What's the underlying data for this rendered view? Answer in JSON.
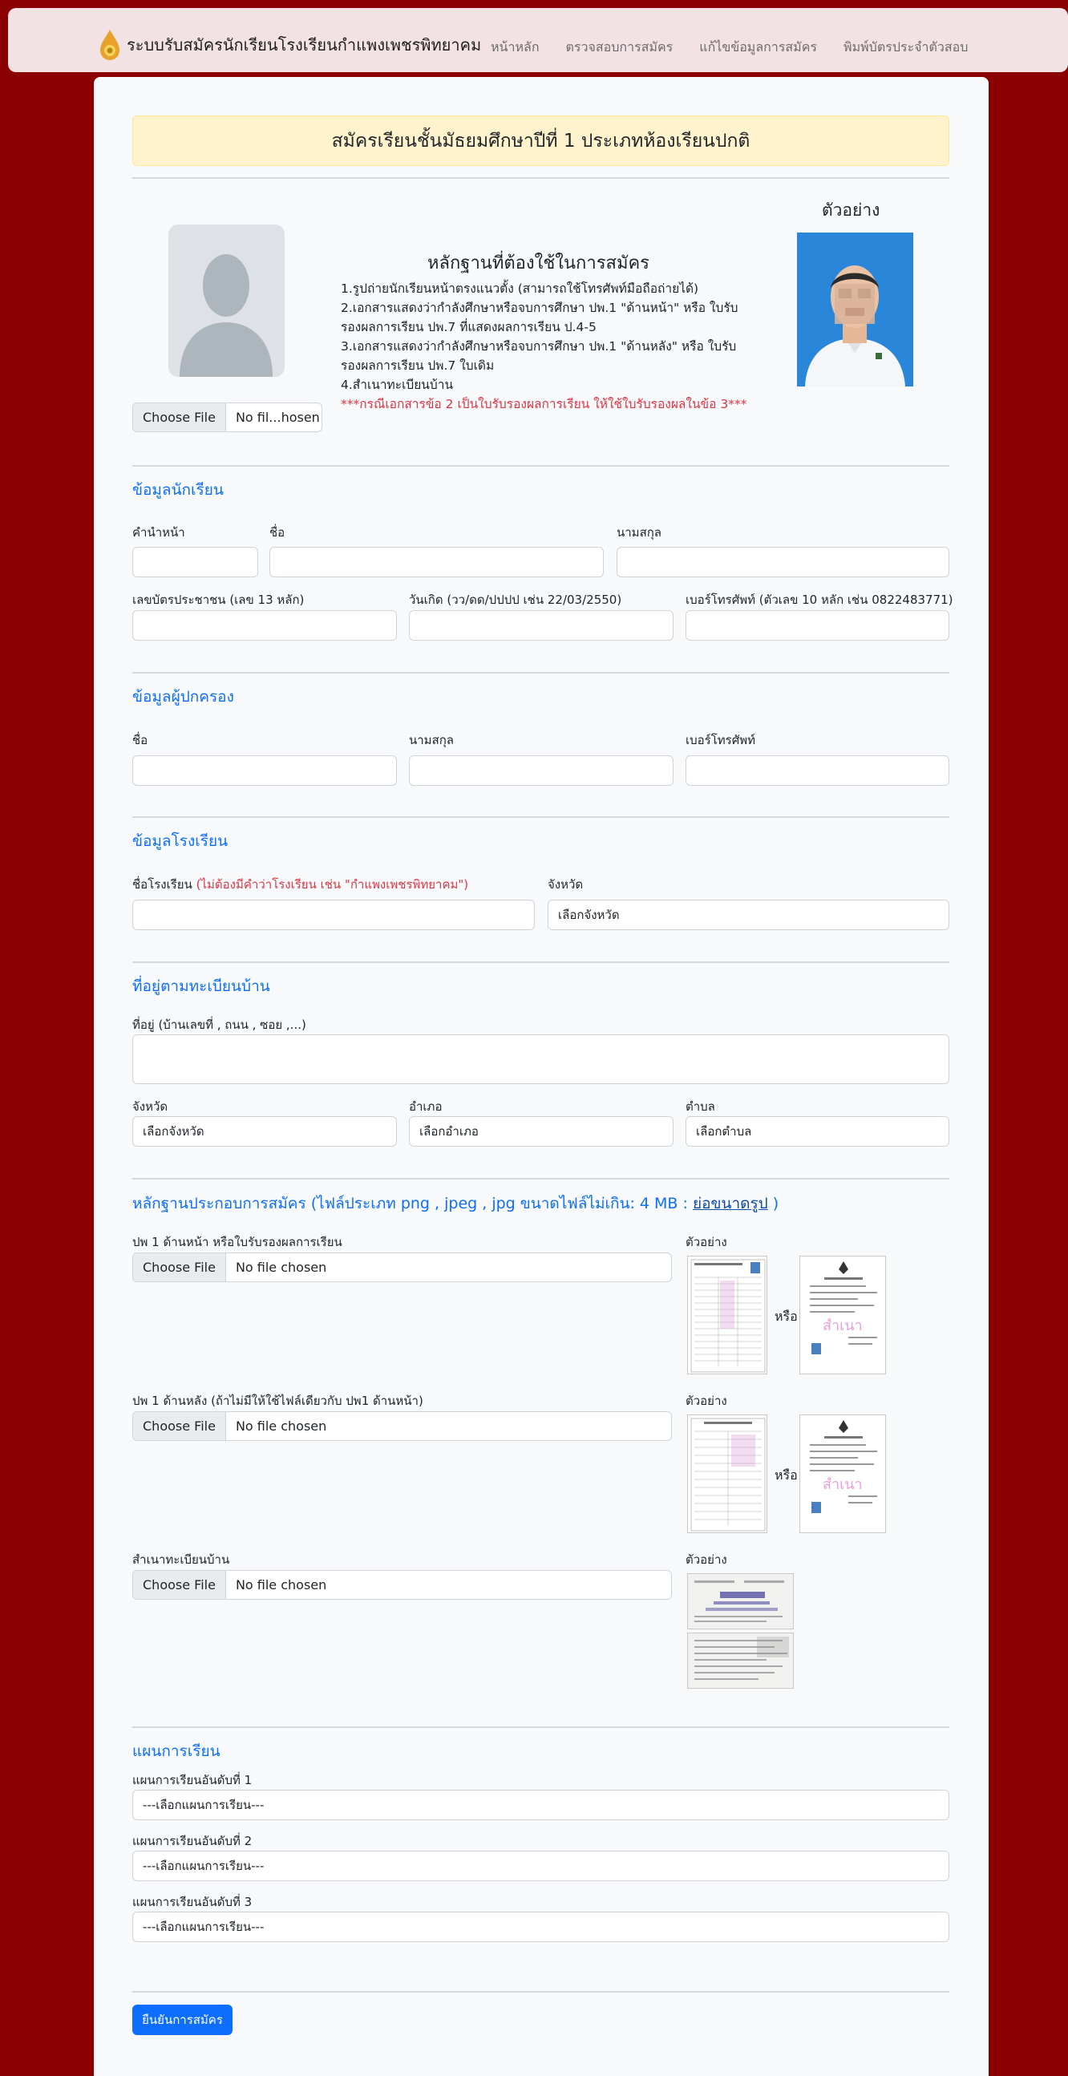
{
  "nav": {
    "brand": "ระบบรับสมัครนักเรียนโรงเรียนกำแพงเพชรพิทยาคม",
    "links": [
      "หน้าหลัก",
      "ตรวจสอบการสมัคร",
      "แก้ไขข้อมูลการสมัคร",
      "พิมพ์บัตรประจำตัวสอบ"
    ]
  },
  "header": {
    "title": "สมัครเรียนชั้นมัธยมศึกษาปีที่ 1 ประเภทห้องเรียนปกติ"
  },
  "photo": {
    "file_button": "Choose File",
    "file_text": "No fil...hosen"
  },
  "requirements": {
    "title": "หลักฐานที่ต้องใช้ในการสมัคร",
    "items": [
      "1.รูปถ่ายนักเรียนหน้าตรงแนวตั้ง (สามารถใช้โทรศัพท์มือถือถ่ายได้)",
      "2.เอกสารแสดงว่ากำลังศึกษาหรือจบการศึกษา ปพ.1 \"ด้านหน้า\" หรือ ใบรับรองผลการเรียน ปพ.7 ที่แสดงผลการเรียน ป.4-5",
      "3.เอกสารแสดงว่ากำลังศึกษาหรือจบการศึกษา ปพ.1 \"ด้านหลัง\" หรือ ใบรับรองผลการเรียน ปพ.7 ใบเดิม",
      "4.สำเนาทะเบียนบ้าน"
    ],
    "note": "***กรณีเอกสารข้อ 2 เป็นใบรับรองผลการเรียน ให้ใช้ใบรับรองผลในข้อ 3***"
  },
  "sample": {
    "title": "ตัวอย่าง"
  },
  "student": {
    "section": "ข้อมูลนักเรียน",
    "prefix": "คำนำหน้า",
    "firstname": "ชื่อ",
    "lastname": "นามสกุล",
    "id_card": "เลขบัตรประชาชน (เลข 13 หลัก)",
    "birthdate": "วันเกิด (วว/ดด/ปปปป เช่น 22/03/2550)",
    "phone": "เบอร์โทรศัพท์ (ตัวเลข 10 หลัก เช่น 0822483771)"
  },
  "guardian": {
    "section": "ข้อมูลผู้ปกครอง",
    "firstname": "ชื่อ",
    "lastname": "นามสกุล",
    "phone": "เบอร์โทรศัพท์"
  },
  "school": {
    "section": "ข้อมูลโรงเรียน",
    "name_label": "ชื่อโรงเรียน",
    "name_hint": "(ไม่ต้องมีคำว่าโรงเรียน เช่น \"กำแพงเพชรพิทยาคม\")",
    "province_label": "จังหวัด",
    "province_value": "เลือกจังหวัด"
  },
  "address": {
    "section": "ที่อยู่ตามทะเบียนบ้าน",
    "address_label": "ที่อยู่ (บ้านเลขที่ , ถนน , ซอย ,...)",
    "province_label": "จังหวัด",
    "province_value": "เลือกจังหวัด",
    "district_label": "อำเภอ",
    "district_value": "เลือกอำเภอ",
    "subdistrict_label": "ตำบล",
    "subdistrict_value": "เลือกตำบล"
  },
  "documents": {
    "section": "หลักฐานประกอบการสมัคร (ไฟล์ประเภท png , jpeg , jpg ขนาดไฟล์ไม่เกิน: 4 MB :",
    "resize_link": "ย่อขนาดรูป",
    "section_end": ")",
    "sample_label": "ตัวอย่าง",
    "or_text": "หรือ",
    "file_button": "Choose File",
    "file_text": "No file chosen",
    "doc1_label": "ปพ 1 ด้านหน้า หรือใบรับรองผลการเรียน",
    "doc2_label": "ปพ 1 ด้านหลัง (ถ้าไม่มีให้ใช้ไฟล์เดียวกับ ปพ1 ด้านหน้า)",
    "doc3_label": "สำเนาทะเบียนบ้าน",
    "cert_stamp": "สำเนา"
  },
  "plan": {
    "section": "แผนการเรียน",
    "choice1": "แผนการเรียนอันดับที่ 1",
    "choice2": "แผนการเรียนอันดับที่ 2",
    "choice3": "แผนการเรียนอันดับที่ 3",
    "placeholder": "---เลือกแผนการเรียน---"
  },
  "submit": "ยืนยันการสมัคร",
  "colors": {
    "background": "#8b0000",
    "accent": "#0d6efd",
    "navbar": "#f2e2e4",
    "alert": "#fff3cd",
    "danger": "#dc3545"
  }
}
